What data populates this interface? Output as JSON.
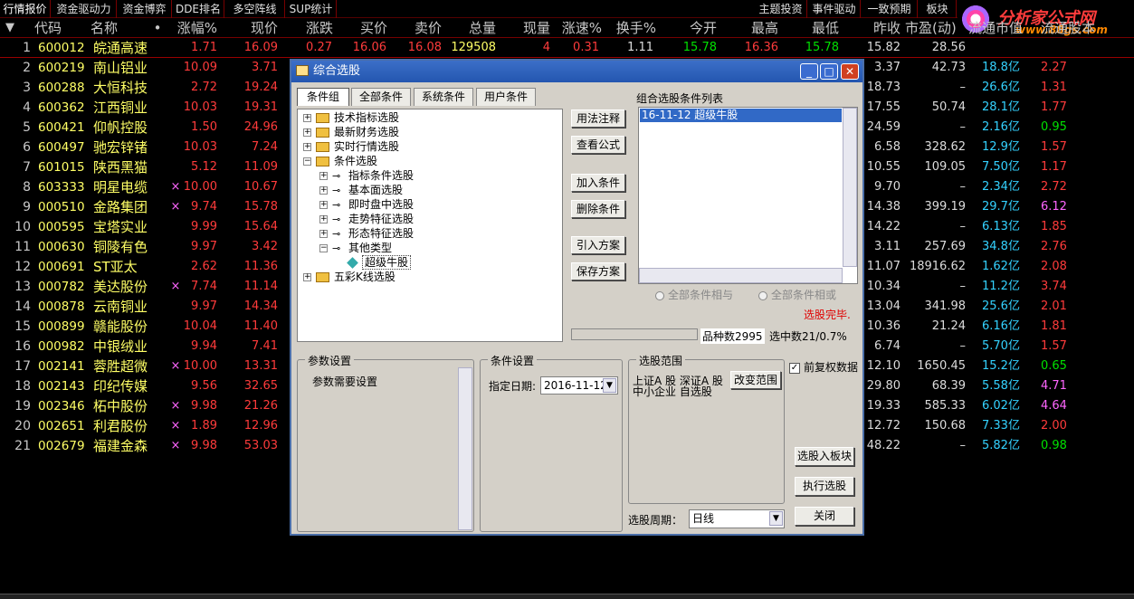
{
  "top_tabs": [
    "行情报价",
    "资金驱动力",
    "资金博弈",
    "DDE排名",
    "多空阵线",
    "SUP统计",
    "主题投资",
    "事件驱动",
    "一致预期",
    "板块"
  ],
  "logo": {
    "name": "分析家公式网",
    "url": "www.88gs.com"
  },
  "columns": [
    "代码",
    "名称",
    "•",
    "涨幅%",
    "现价",
    "涨跌",
    "买价",
    "卖价",
    "总量",
    "现量",
    "涨速%",
    "换手%",
    "今开",
    "最高",
    "最低",
    "昨收",
    "市盈(动)",
    "流通市值",
    "流通股本"
  ],
  "rows": [
    {
      "i": "1",
      "code": "600012",
      "name": "皖通高速",
      "mark": "",
      "chg": "1.71",
      "price": "16.09",
      "diff": "0.27",
      "buy": "16.06",
      "sell": "16.08",
      "vol": "129508",
      "cur": "4",
      "spd": "0.31",
      "turn": "1.11",
      "open": "15.78",
      "high": "16.36",
      "low": "15.78",
      "prev": "15.82",
      "pe": "28.56",
      "cap": "",
      "cap2": ""
    },
    {
      "i": "2",
      "code": "600219",
      "name": "南山铝业",
      "mark": "",
      "chg": "10.09",
      "price": "3.71",
      "prev": "3.37",
      "pe": "42.73",
      "cap": "18.8亿",
      "cap2": "2.27"
    },
    {
      "i": "3",
      "code": "600288",
      "name": "大恒科技",
      "mark": "",
      "chg": "2.72",
      "price": "19.24",
      "prev": "18.73",
      "pe": "–",
      "cap": "26.6亿",
      "cap2": "1.31"
    },
    {
      "i": "4",
      "code": "600362",
      "name": "江西铜业",
      "mark": "",
      "chg": "10.03",
      "price": "19.31",
      "prev": "17.55",
      "pe": "50.74",
      "cap": "28.1亿",
      "cap2": "1.77"
    },
    {
      "i": "5",
      "code": "600421",
      "name": "仰帆控股",
      "mark": "",
      "chg": "1.50",
      "price": "24.96",
      "prev": "24.59",
      "pe": "–",
      "cap": "2.16亿",
      "cap2": "0.95"
    },
    {
      "i": "6",
      "code": "600497",
      "name": "驰宏锌锗",
      "mark": "",
      "chg": "10.03",
      "price": "7.24",
      "prev": "6.58",
      "pe": "328.62",
      "cap": "12.9亿",
      "cap2": "1.57"
    },
    {
      "i": "7",
      "code": "601015",
      "name": "陕西黑猫",
      "mark": "",
      "chg": "5.12",
      "price": "11.09",
      "prev": "10.55",
      "pe": "109.05",
      "cap": "7.50亿",
      "cap2": "1.17"
    },
    {
      "i": "8",
      "code": "603333",
      "name": "明星电缆",
      "mark": "×",
      "chg": "10.00",
      "price": "10.67",
      "prev": "9.70",
      "pe": "–",
      "cap": "2.34亿",
      "cap2": "2.72"
    },
    {
      "i": "9",
      "code": "000510",
      "name": "金路集团",
      "mark": "×",
      "chg": "9.74",
      "price": "15.78",
      "prev": "14.38",
      "pe": "399.19",
      "cap": "29.7亿",
      "cap2": "6.12"
    },
    {
      "i": "10",
      "code": "000595",
      "name": "宝塔实业",
      "mark": "",
      "chg": "9.99",
      "price": "15.64",
      "prev": "14.22",
      "pe": "–",
      "cap": "6.13亿",
      "cap2": "1.85"
    },
    {
      "i": "11",
      "code": "000630",
      "name": "铜陵有色",
      "mark": "",
      "chg": "9.97",
      "price": "3.42",
      "prev": "3.11",
      "pe": "257.69",
      "cap": "34.8亿",
      "cap2": "2.76"
    },
    {
      "i": "12",
      "code": "000691",
      "name": "ST亚太",
      "mark": "",
      "chg": "2.62",
      "price": "11.36",
      "prev": "11.07",
      "pe": "18916.62",
      "cap": "1.62亿",
      "cap2": "2.08"
    },
    {
      "i": "13",
      "code": "000782",
      "name": "美达股份",
      "mark": "×",
      "chg": "7.74",
      "price": "11.14",
      "prev": "10.34",
      "pe": "–",
      "cap": "11.2亿",
      "cap2": "3.74"
    },
    {
      "i": "14",
      "code": "000878",
      "name": "云南铜业",
      "mark": "",
      "chg": "9.97",
      "price": "14.34",
      "prev": "13.04",
      "pe": "341.98",
      "cap": "25.6亿",
      "cap2": "2.01"
    },
    {
      "i": "15",
      "code": "000899",
      "name": "赣能股份",
      "mark": "",
      "chg": "10.04",
      "price": "11.40",
      "prev": "10.36",
      "pe": "21.24",
      "cap": "6.16亿",
      "cap2": "1.81"
    },
    {
      "i": "16",
      "code": "000982",
      "name": "中银绒业",
      "mark": "",
      "chg": "9.94",
      "price": "7.41",
      "prev": "6.74",
      "pe": "–",
      "cap": "5.70亿",
      "cap2": "1.57"
    },
    {
      "i": "17",
      "code": "002141",
      "name": "蓉胜超微",
      "mark": "×",
      "chg": "10.00",
      "price": "13.31",
      "prev": "12.10",
      "pe": "1650.45",
      "cap": "15.2亿",
      "cap2": "0.65"
    },
    {
      "i": "18",
      "code": "002143",
      "name": "印纪传媒",
      "mark": "",
      "chg": "9.56",
      "price": "32.65",
      "prev": "29.80",
      "pe": "68.39",
      "cap": "5.58亿",
      "cap2": "4.71"
    },
    {
      "i": "19",
      "code": "002346",
      "name": "柘中股份",
      "mark": "×",
      "chg": "9.98",
      "price": "21.26",
      "prev": "19.33",
      "pe": "585.33",
      "cap": "6.02亿",
      "cap2": "4.64"
    },
    {
      "i": "20",
      "code": "002651",
      "name": "利君股份",
      "mark": "×",
      "chg": "1.89",
      "price": "12.96",
      "prev": "12.72",
      "pe": "150.68",
      "cap": "7.33亿",
      "cap2": "2.00"
    },
    {
      "i": "21",
      "code": "002679",
      "name": "福建金森",
      "mark": "×",
      "chg": "9.98",
      "price": "53.03",
      "prev": "48.22",
      "pe": "–",
      "cap": "5.82亿",
      "cap2": "0.98"
    }
  ],
  "dialog": {
    "title": "综合选股",
    "tabs": [
      "条件组",
      "全部条件",
      "系统条件",
      "用户条件"
    ],
    "tree": [
      {
        "label": "技术指标选股",
        "lvl": 0,
        "pm": "+",
        "kind": "folder"
      },
      {
        "label": "最新财务选股",
        "lvl": 0,
        "pm": "+",
        "kind": "folder"
      },
      {
        "label": "实时行情选股",
        "lvl": 0,
        "pm": "+",
        "kind": "folder"
      },
      {
        "label": "条件选股",
        "lvl": 0,
        "pm": "−",
        "kind": "folder"
      },
      {
        "label": "指标条件选股",
        "lvl": 1,
        "pm": "+",
        "kind": "key"
      },
      {
        "label": "基本面选股",
        "lvl": 1,
        "pm": "+",
        "kind": "key"
      },
      {
        "label": "即时盘中选股",
        "lvl": 1,
        "pm": "+",
        "kind": "key"
      },
      {
        "label": "走势特征选股",
        "lvl": 1,
        "pm": "+",
        "kind": "key"
      },
      {
        "label": "形态特征选股",
        "lvl": 1,
        "pm": "+",
        "kind": "key"
      },
      {
        "label": "其他类型",
        "lvl": 1,
        "pm": "−",
        "kind": "key"
      },
      {
        "label": "超级牛股",
        "lvl": 2,
        "pm": "",
        "kind": "gem"
      },
      {
        "label": "五彩K线选股",
        "lvl": 0,
        "pm": "+",
        "kind": "folder"
      }
    ],
    "buttons": {
      "usage": "用法注释",
      "view_formula": "查看公式",
      "add_cond": "加入条件",
      "del_cond": "删除条件",
      "import_plan": "引入方案",
      "save_plan": "保存方案",
      "to_block": "选股入板块",
      "execute": "执行选股",
      "close": "关闭",
      "change_range": "改变范围"
    },
    "cond_list_title": "组合选股条件列表",
    "cond_list_item": "16-11-12 超级牛股",
    "radio_and": "全部条件相与",
    "radio_or": "全部条件相或",
    "status_done": "选股完毕.",
    "count_label": "品种数2995",
    "selected_label": "选中数21/0.7%",
    "param_title": "参数设置",
    "param_text": "参数需要设置",
    "cond_set_title": "条件设置",
    "date_label": "指定日期:",
    "date_value": "2016-11-12",
    "range_title": "选股范围",
    "range_text1": "上证A 股  深证A 股",
    "range_text2": "中小企业  自选股",
    "fq_label": "前复权数据",
    "period_label": "选股周期：",
    "period_value": "日线"
  }
}
